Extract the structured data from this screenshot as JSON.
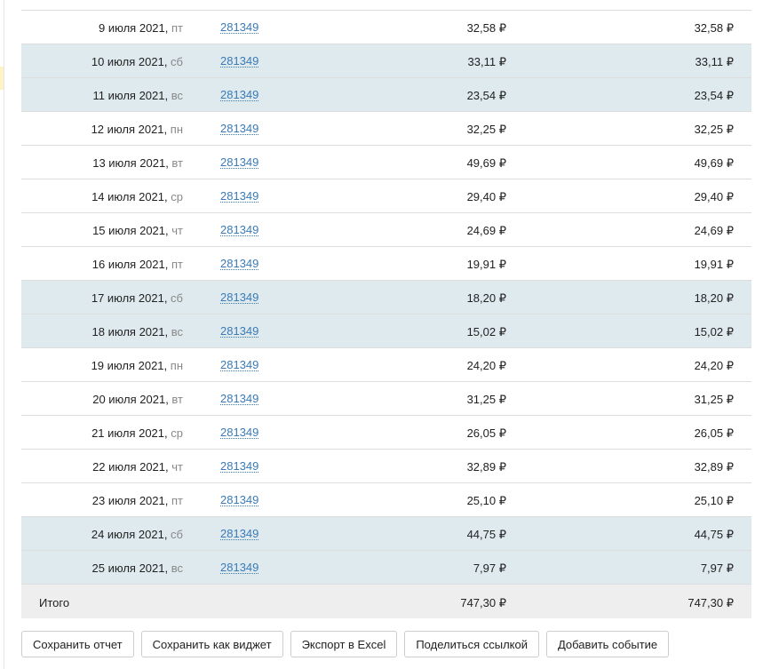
{
  "rows": [
    {
      "date": "9 июля 2021",
      "dow": "пт",
      "id": "281349",
      "v1": "32,58 ₽",
      "v2": "32,58 ₽",
      "weekend": false
    },
    {
      "date": "10 июля 2021",
      "dow": "сб",
      "id": "281349",
      "v1": "33,11 ₽",
      "v2": "33,11 ₽",
      "weekend": true
    },
    {
      "date": "11 июля 2021",
      "dow": "вс",
      "id": "281349",
      "v1": "23,54 ₽",
      "v2": "23,54 ₽",
      "weekend": true
    },
    {
      "date": "12 июля 2021",
      "dow": "пн",
      "id": "281349",
      "v1": "32,25 ₽",
      "v2": "32,25 ₽",
      "weekend": false
    },
    {
      "date": "13 июля 2021",
      "dow": "вт",
      "id": "281349",
      "v1": "49,69 ₽",
      "v2": "49,69 ₽",
      "weekend": false
    },
    {
      "date": "14 июля 2021",
      "dow": "ср",
      "id": "281349",
      "v1": "29,40 ₽",
      "v2": "29,40 ₽",
      "weekend": false
    },
    {
      "date": "15 июля 2021",
      "dow": "чт",
      "id": "281349",
      "v1": "24,69 ₽",
      "v2": "24,69 ₽",
      "weekend": false
    },
    {
      "date": "16 июля 2021",
      "dow": "пт",
      "id": "281349",
      "v1": "19,91 ₽",
      "v2": "19,91 ₽",
      "weekend": false
    },
    {
      "date": "17 июля 2021",
      "dow": "сб",
      "id": "281349",
      "v1": "18,20 ₽",
      "v2": "18,20 ₽",
      "weekend": true
    },
    {
      "date": "18 июля 2021",
      "dow": "вс",
      "id": "281349",
      "v1": "15,02 ₽",
      "v2": "15,02 ₽",
      "weekend": true
    },
    {
      "date": "19 июля 2021",
      "dow": "пн",
      "id": "281349",
      "v1": "24,20 ₽",
      "v2": "24,20 ₽",
      "weekend": false
    },
    {
      "date": "20 июля 2021",
      "dow": "вт",
      "id": "281349",
      "v1": "31,25 ₽",
      "v2": "31,25 ₽",
      "weekend": false
    },
    {
      "date": "21 июля 2021",
      "dow": "ср",
      "id": "281349",
      "v1": "26,05 ₽",
      "v2": "26,05 ₽",
      "weekend": false
    },
    {
      "date": "22 июля 2021",
      "dow": "чт",
      "id": "281349",
      "v1": "32,89 ₽",
      "v2": "32,89 ₽",
      "weekend": false
    },
    {
      "date": "23 июля 2021",
      "dow": "пт",
      "id": "281349",
      "v1": "25,10 ₽",
      "v2": "25,10 ₽",
      "weekend": false
    },
    {
      "date": "24 июля 2021",
      "dow": "сб",
      "id": "281349",
      "v1": "44,75 ₽",
      "v2": "44,75 ₽",
      "weekend": true
    },
    {
      "date": "25 июля 2021",
      "dow": "вс",
      "id": "281349",
      "v1": "7,97 ₽",
      "v2": "7,97 ₽",
      "weekend": true
    }
  ],
  "total": {
    "label": "Итого",
    "v1": "747,30 ₽",
    "v2": "747,30 ₽"
  },
  "buttons": [
    "Сохранить отчет",
    "Сохранить как виджет",
    "Экспорт в Excel",
    "Поделиться ссылкой",
    "Добавить событие"
  ]
}
